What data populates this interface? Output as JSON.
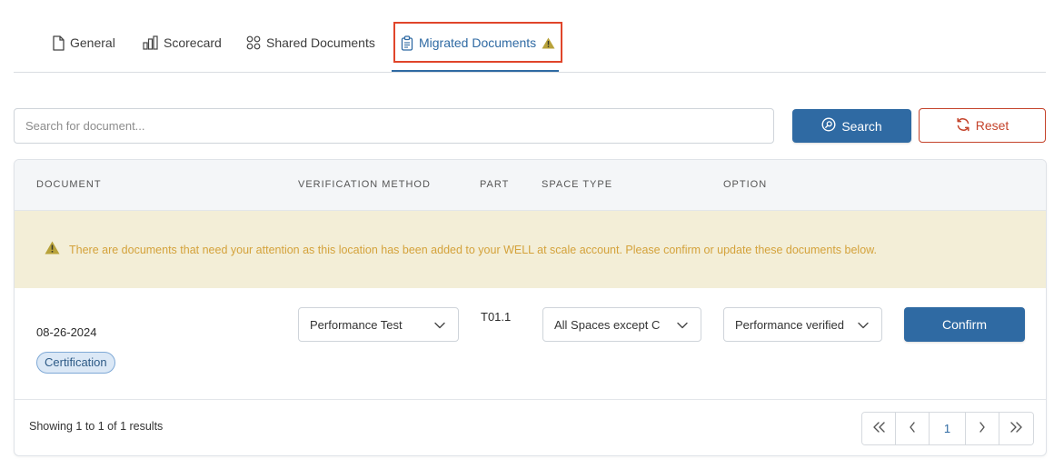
{
  "tabs": [
    {
      "label": "General",
      "icon": "file-icon"
    },
    {
      "label": "Scorecard",
      "icon": "bar-chart-icon"
    },
    {
      "label": "Shared Documents",
      "icon": "grid-icon"
    },
    {
      "label": "Migrated Documents",
      "icon": "clipboard-icon",
      "active": true,
      "warning": true
    }
  ],
  "search": {
    "placeholder": "Search for document...",
    "value": "",
    "search_label": "Search",
    "reset_label": "Reset"
  },
  "table": {
    "headers": [
      "DOCUMENT",
      "VERIFICATION METHOD",
      "PART",
      "SPACE TYPE",
      "OPTION"
    ],
    "alert": "There are documents that need your attention as this location has been added to your WELL at scale account. Please confirm or update these documents below.",
    "rows": [
      {
        "date": "08-26-2024",
        "badge": "Certification",
        "verification_method": "Performance Test",
        "part": "T01.1",
        "space_type": "All Spaces except C",
        "option": "Performance verified",
        "confirm_label": "Confirm"
      }
    ]
  },
  "footer": {
    "summary": "Showing 1 to 1 of 1 results",
    "current_page": "1"
  },
  "colors": {
    "primary": "#2f6aa3",
    "reset": "#c4432b",
    "alert_bg": "#f3eed7",
    "alert_text": "#d4a23b",
    "highlight": "#e0452a"
  }
}
